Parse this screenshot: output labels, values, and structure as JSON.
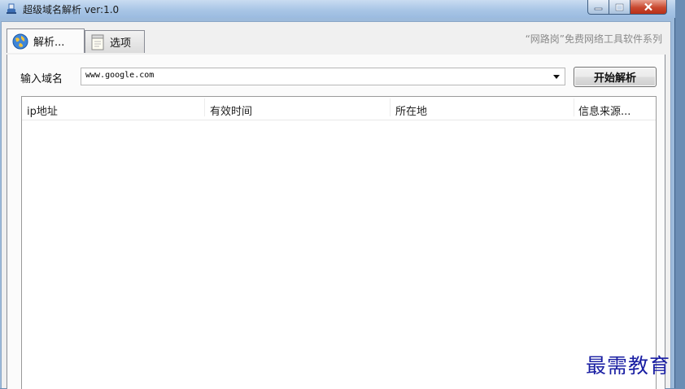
{
  "window": {
    "title": "超级域名解析 ver:1.0"
  },
  "tabs": [
    {
      "label": "解析..."
    },
    {
      "label": "选项"
    }
  ],
  "promo_text": "“网路岗”免费网络工具软件系列",
  "form": {
    "domain_label": "输入域名",
    "domain_value": "www.google.com",
    "start_button_label": "开始解析"
  },
  "result_table": {
    "columns": [
      "ip地址",
      "有效时间",
      "所在地",
      "信息来源..."
    ],
    "rows": []
  },
  "watermark": "最需教育",
  "colors": {
    "title_bar": "#a9c6e6",
    "close_button": "#c8482f",
    "panel_background": "#fbfbfb",
    "watermark": "#1a1fa3"
  }
}
